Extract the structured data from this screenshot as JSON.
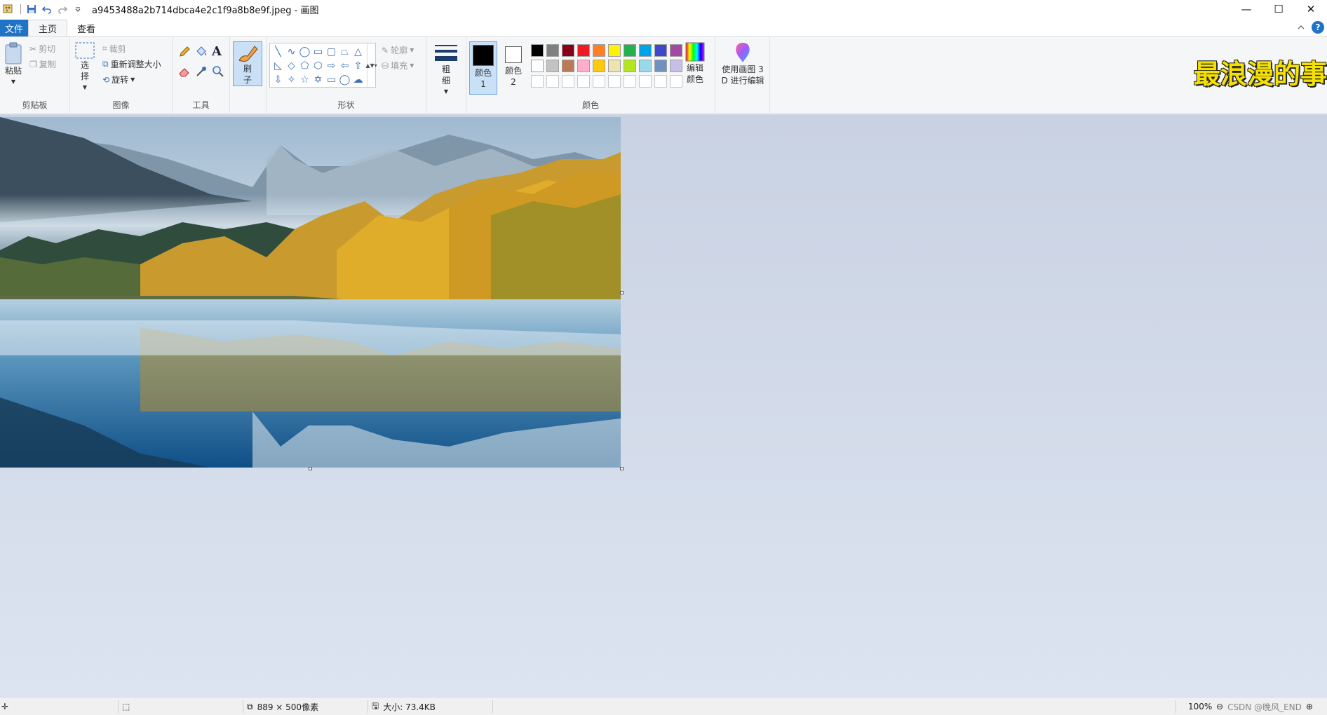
{
  "window": {
    "title": "a9453488a2b714dbca4e2c1f9a8b8e9f.jpeg - 画图",
    "controls": {
      "minimize": "—",
      "maximize": "☐",
      "close": "✕"
    }
  },
  "tabs": [
    {
      "label": "文件"
    },
    {
      "label": "主页"
    },
    {
      "label": "查看"
    }
  ],
  "ribbon": {
    "clipboard": {
      "label": "剪贴板",
      "paste": "粘贴",
      "cut": "剪切",
      "copy": "复制"
    },
    "image": {
      "label": "图像",
      "select": "选择",
      "crop": "裁剪",
      "resize": "重新调整大小",
      "rotate": "旋转"
    },
    "tools": {
      "label": "工具"
    },
    "brushes": {
      "label": "刷子"
    },
    "shapes": {
      "label": "形状",
      "outline": "轮廓",
      "fill": "填充"
    },
    "size": {
      "label": "粗细"
    },
    "colors": {
      "label": "颜色",
      "color1": "颜色 1",
      "color2": "颜色 2",
      "edit": "编辑颜色",
      "palette_row1": [
        "#000000",
        "#7f7f7f",
        "#880015",
        "#ed1c24",
        "#ff7f27",
        "#fff200",
        "#22b14c",
        "#00a2e8",
        "#3f48cc",
        "#a349a4"
      ],
      "palette_row2": [
        "#ffffff",
        "#c3c3c3",
        "#b97a57",
        "#ffaec9",
        "#ffc90e",
        "#efe4b0",
        "#b5e61d",
        "#99d9ea",
        "#7092be",
        "#c8bfe7"
      ]
    },
    "paint3d": {
      "label": "使用画图 3 D 进行编辑"
    }
  },
  "sticker_text": "最浪漫的事",
  "status": {
    "dimensions": "889 × 500像素",
    "size": "大小: 73.4KB",
    "zoom": "100%",
    "watermark": "CSDN @晚风_END"
  }
}
